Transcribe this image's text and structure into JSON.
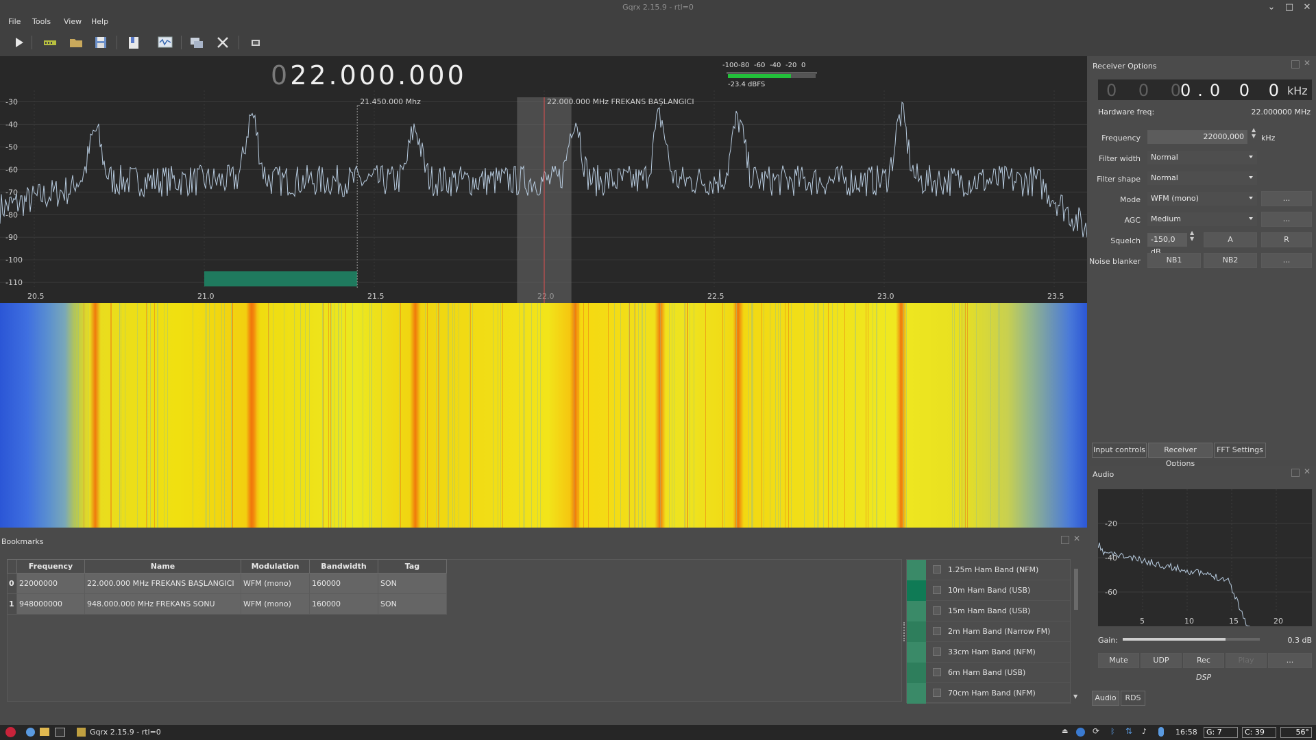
{
  "window": {
    "title": "Gqrx 2.15.9 - rtl=0"
  },
  "menu": {
    "file": "File",
    "tools": "Tools",
    "view": "View",
    "help": "Help"
  },
  "toolbar_icons": [
    "play-icon",
    "hardware-icon",
    "open-icon",
    "save-icon",
    "bookmark-icon",
    "iq-tool-icon",
    "remote-icon",
    "settings-icon",
    "dock-icon"
  ],
  "display": {
    "freq_leading": "0",
    "freq_main": "22.000.000",
    "meter_ticks": [
      "-100",
      "-80",
      "-60",
      "-40",
      "-20",
      "0"
    ],
    "meter_level": "-23.4 dBFS",
    "meter_level_fraction": 0.72,
    "marker1_label": "21.450.000 Mhz",
    "marker2_label": "22.000.000 MHz FREKANS BAŞLANGICI"
  },
  "chart_data": {
    "type": "line",
    "title": "",
    "xlabel": "",
    "ylabel": "",
    "x_ticks": [
      "20.5",
      "21.0",
      "21.5",
      "22.0",
      "22.5",
      "23.0",
      "23.5"
    ],
    "y_ticks": [
      "-30",
      "-40",
      "-50",
      "-60",
      "-70",
      "-80",
      "-90",
      "-100",
      "-110"
    ],
    "xlim": [
      20.4,
      23.6
    ],
    "ylim": [
      -113,
      -25
    ],
    "grid": true,
    "peaks": [
      {
        "x": 20.68,
        "y": -43
      },
      {
        "x": 21.14,
        "y": -36
      },
      {
        "x": 21.62,
        "y": -42
      },
      {
        "x": 22.09,
        "y": -37
      },
      {
        "x": 22.34,
        "y": -37
      },
      {
        "x": 22.57,
        "y": -38
      },
      {
        "x": 23.05,
        "y": -36
      }
    ],
    "noise_floor": -65,
    "filter_band": [
      21.92,
      22.08
    ],
    "center_freq": 22.0,
    "bookmark_band": [
      21.0,
      21.45
    ]
  },
  "receiver": {
    "header": "Receiver Options",
    "freq_digits_dim": "0 0 0",
    "freq_digits": "0.0 0 0",
    "freq_unit": "kHz",
    "hw_label": "Hardware freq:",
    "hw_value": "22.000000 MHz",
    "frequency_label": "Frequency",
    "frequency_value": "22000,000",
    "frequency_unit": "kHz",
    "filter_width_label": "Filter width",
    "filter_width_value": "Normal",
    "filter_shape_label": "Filter shape",
    "filter_shape_value": "Normal",
    "mode_label": "Mode",
    "mode_value": "WFM (mono)",
    "agc_label": "AGC",
    "agc_value": "Medium",
    "squelch_label": "Squelch",
    "squelch_value": "-150,0 dB",
    "squelch_a": "A",
    "squelch_r": "R",
    "nb_label": "Noise blanker",
    "nb1": "NB1",
    "nb2": "NB2",
    "ellipsis": "...",
    "tabs": [
      "Input controls",
      "Receiver Options",
      "FFT Settings"
    ]
  },
  "audio": {
    "header": "Audio",
    "y_ticks": [
      "-20",
      "-40",
      "-60"
    ],
    "x_ticks": [
      "5",
      "10",
      "15",
      "20"
    ],
    "gain_label": "Gain:",
    "gain_value": "0.3 dB",
    "gain_fraction": 0.75,
    "mute": "Mute",
    "udp": "UDP",
    "rec": "Rec",
    "play": "Play",
    "ellipsis": "...",
    "dsp": "DSP",
    "tabs": [
      "Audio",
      "RDS"
    ]
  },
  "bookmarks": {
    "header": "Bookmarks",
    "columns": [
      "Frequency",
      "Name",
      "Modulation",
      "Bandwidth",
      "Tag"
    ],
    "rows": [
      {
        "idx": "0",
        "frequency": "22000000",
        "name": "22.000.000 MHz FREKANS BAŞLANGICI",
        "modulation": "WFM (mono)",
        "bandwidth": "160000",
        "tag": "SON"
      },
      {
        "idx": "1",
        "frequency": "948000000",
        "name": "948.000.000 MHz FREKANS SONU",
        "modulation": "WFM (mono)",
        "bandwidth": "160000",
        "tag": "SON"
      }
    ],
    "tags": [
      {
        "name": "1.25m Ham Band (NFM)",
        "color": "#3a8a68"
      },
      {
        "name": "10m Ham Band (USB)",
        "color": "#0f7a55"
      },
      {
        "name": "15m Ham Band (USB)",
        "color": "#3a8a68"
      },
      {
        "name": "2m Ham Band (Narrow FM)",
        "color": "#2e7e5c"
      },
      {
        "name": "33cm Ham Band (NFM)",
        "color": "#3a8a68"
      },
      {
        "name": "6m Ham Band (USB)",
        "color": "#2e7e5c"
      },
      {
        "name": "70cm Ham Band (NFM)",
        "color": "#3a8a68"
      }
    ]
  },
  "taskbar": {
    "app": "Gqrx 2.15.9 - rtl=0",
    "time": "16:58",
    "g": "G:  7",
    "c": "C: 39",
    "temp": "56°"
  }
}
